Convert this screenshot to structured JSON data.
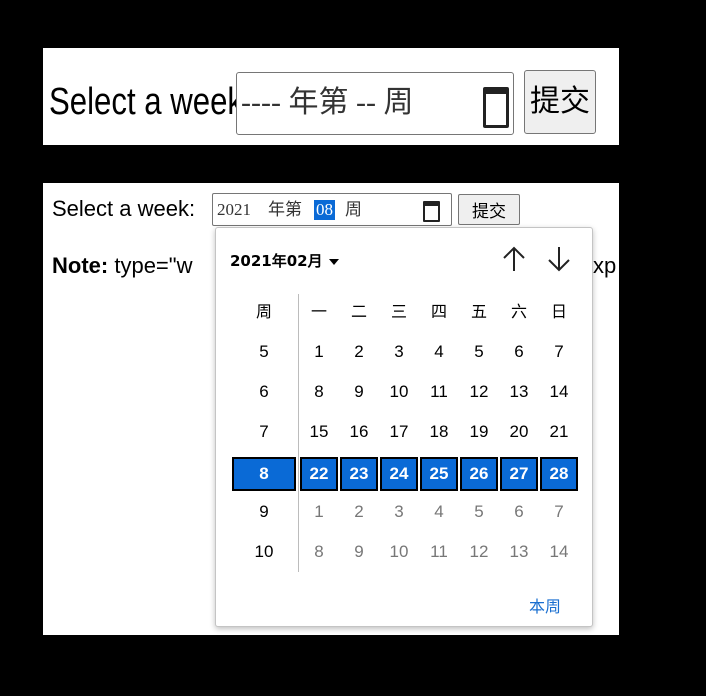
{
  "top_form": {
    "label": "Select a week:",
    "input_display": "---- 年第 -- 周",
    "submit_label": "提交"
  },
  "week_form": {
    "label": "Select a week:",
    "year_value": "2021",
    "year_suffix": "年第",
    "week_value": "08",
    "week_suffix": "周",
    "submit_label": "提交"
  },
  "note": {
    "bold": "Note:",
    "text": "type=\"w",
    "tail": "xp"
  },
  "calendar": {
    "month_label": "2021年02月",
    "week_header": "周",
    "weekday_headers": [
      "一",
      "二",
      "三",
      "四",
      "五",
      "六",
      "日"
    ],
    "rows": [
      {
        "week": "5",
        "days": [
          "1",
          "2",
          "3",
          "4",
          "5",
          "6",
          "7"
        ],
        "other": [
          false,
          false,
          false,
          false,
          false,
          false,
          false
        ]
      },
      {
        "week": "6",
        "days": [
          "8",
          "9",
          "10",
          "11",
          "12",
          "13",
          "14"
        ],
        "other": [
          false,
          false,
          false,
          false,
          false,
          false,
          false
        ]
      },
      {
        "week": "7",
        "days": [
          "15",
          "16",
          "17",
          "18",
          "19",
          "20",
          "21"
        ],
        "other": [
          false,
          false,
          false,
          false,
          false,
          false,
          false
        ]
      },
      {
        "week": "8",
        "days": [
          "22",
          "23",
          "24",
          "25",
          "26",
          "27",
          "28"
        ],
        "other": [
          false,
          false,
          false,
          false,
          false,
          false,
          false
        ],
        "selected": true
      },
      {
        "week": "9",
        "days": [
          "1",
          "2",
          "3",
          "4",
          "5",
          "6",
          "7"
        ],
        "other": [
          true,
          true,
          true,
          true,
          true,
          true,
          true
        ]
      },
      {
        "week": "10",
        "days": [
          "8",
          "9",
          "10",
          "11",
          "12",
          "13",
          "14"
        ],
        "other": [
          true,
          true,
          true,
          true,
          true,
          true,
          true
        ]
      }
    ],
    "this_week_label": "本周",
    "colors": {
      "selection": "#0a6ad6",
      "link": "#1a6fd0",
      "muted": "#777777"
    },
    "icons": [
      "chevron-down-icon",
      "arrow-up-icon",
      "arrow-down-icon",
      "calendar-icon"
    ]
  }
}
